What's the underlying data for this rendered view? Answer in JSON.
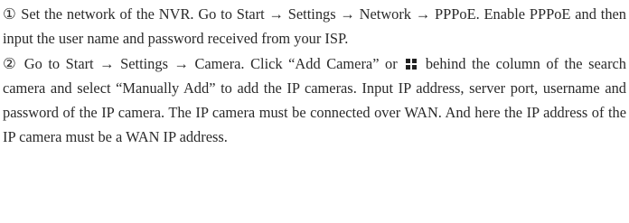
{
  "steps": [
    {
      "number": "①",
      "text": " Set the network of the NVR. Go to Start → Settings → Network → PPPoE. Enable PPPoE and then input the user name and password received from your ISP."
    },
    {
      "number": "②",
      "text_before_icon": " Go to Start → Settings → Camera. Click “Add Camera” or",
      "icon": "grid-add-icon",
      "text_after_icon": "behind the column of the search camera and select “Manually Add” to add the IP cameras. Input IP address, server port, username and password of the IP camera. The IP camera must be connected over WAN. And here the IP address of the IP camera must be a WAN IP address."
    }
  ]
}
